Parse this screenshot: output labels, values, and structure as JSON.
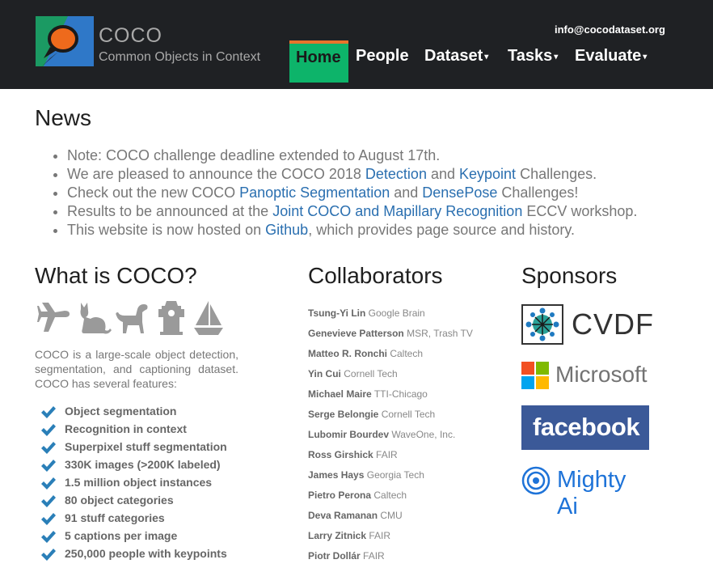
{
  "header": {
    "brand_name": "COCO",
    "brand_subtitle": "Common Objects in Context",
    "email": "info@cocodataset.org",
    "nav": [
      {
        "label": "Home",
        "active": true
      },
      {
        "label": "People"
      },
      {
        "label": "Dataset",
        "dropdown": true
      },
      {
        "label": "Tasks",
        "dropdown": true
      },
      {
        "label": "Evaluate",
        "dropdown": true
      }
    ]
  },
  "news": {
    "title": "News",
    "items": [
      {
        "before": "Note: COCO challenge deadline extended to August 17th."
      },
      {
        "before": "We are pleased to announce the COCO 2018 ",
        "link1": "Detection",
        "mid": " and ",
        "link2": "Keypoint",
        "after": " Challenges."
      },
      {
        "before": "Check out the new COCO ",
        "link1": "Panoptic Segmentation",
        "mid": " and ",
        "link2": "DensePose",
        "after": " Challenges!"
      },
      {
        "before": "Results to be announced at the ",
        "link1": "Joint COCO and Mapillary Recognition",
        "after": " ECCV workshop."
      },
      {
        "before": "This website is now hosted on ",
        "link1": "Github",
        "after": ", which provides page source and history."
      }
    ]
  },
  "about": {
    "title": "What is COCO?",
    "icons": [
      "airplane-icon",
      "cat-icon",
      "dog-icon",
      "fire-hydrant-icon",
      "sailboat-icon"
    ],
    "description": "COCO is a large-scale object detection, segmentation, and captioning dataset. COCO has several features:",
    "features": [
      "Object segmentation",
      "Recognition in context",
      "Superpixel stuff segmentation",
      "330K images (>200K labeled)",
      "1.5 million object instances",
      "80 object categories",
      "91 stuff categories",
      "5 captions per image",
      "250,000 people with keypoints"
    ]
  },
  "collaborators": {
    "title": "Collaborators",
    "people": [
      {
        "name": "Tsung-Yi Lin",
        "org": "Google Brain"
      },
      {
        "name": "Genevieve Patterson",
        "org": "MSR, Trash TV"
      },
      {
        "name": "Matteo R. Ronchi",
        "org": "Caltech"
      },
      {
        "name": "Yin Cui",
        "org": "Cornell Tech"
      },
      {
        "name": "Michael Maire",
        "org": "TTI-Chicago"
      },
      {
        "name": "Serge Belongie",
        "org": "Cornell Tech"
      },
      {
        "name": "Lubomir Bourdev",
        "org": "WaveOne, Inc."
      },
      {
        "name": "Ross Girshick",
        "org": "FAIR"
      },
      {
        "name": "James Hays",
        "org": "Georgia Tech"
      },
      {
        "name": "Pietro Perona",
        "org": "Caltech"
      },
      {
        "name": "Deva Ramanan",
        "org": "CMU"
      },
      {
        "name": "Larry Zitnick",
        "org": "FAIR"
      },
      {
        "name": "Piotr Dollár",
        "org": "FAIR"
      }
    ]
  },
  "sponsors": {
    "title": "Sponsors",
    "items": [
      {
        "name": "CVDF",
        "icon": "cvdf-logo"
      },
      {
        "name": "Microsoft",
        "icon": "microsoft-logo"
      },
      {
        "name": "facebook",
        "icon": "facebook-logo",
        "color": "#3b5998"
      },
      {
        "name": "Mighty Ai",
        "icon": "mighty-ai-logo",
        "color": "#1e73d8"
      }
    ]
  },
  "colors": {
    "header_bg": "#1f2124",
    "nav_active_bg": "#0db46a",
    "nav_active_border": "#e8742b",
    "link": "#2a6fb0",
    "check": "#2a7fb8",
    "icon_gray": "#9a9a9a"
  }
}
